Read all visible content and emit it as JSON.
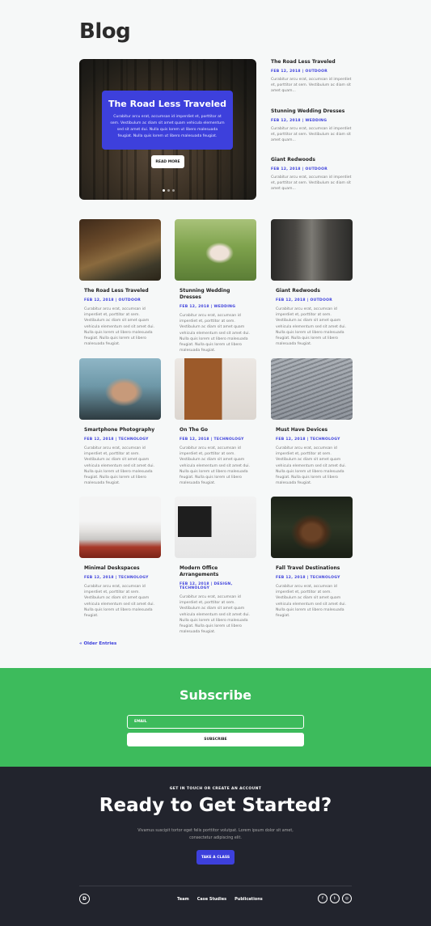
{
  "header": {
    "title": "Blog"
  },
  "slider": {
    "title": "The Road Less Traveled",
    "text": "Curabitur arcu erat, accumsan id imperdiet et, porttitor at sem. Vestibulum ac diam sit amet quam vehicula elementum sed sit amet dui. Nulla quis lorem ut libero malesuada feugiat. Nulla quis lorem ut libero malesuada feugiat.",
    "button": "READ MORE"
  },
  "side_posts": [
    {
      "title": "The Road Less Traveled",
      "meta": "FEB 12, 2018 | OUTDOOR",
      "excerpt": "Curabitur arcu erat, accumsan id imperdiet et, porttitor at sem. Vestibulum ac diam sit amet quam..."
    },
    {
      "title": "Stunning Wedding Dresses",
      "meta": "FEB 12, 2018 | WEDDING",
      "excerpt": "Curabitur arcu erat, accumsan id imperdiet et, porttitor at sem. Vestibulum ac diam sit amet quam..."
    },
    {
      "title": "Giant Redwoods",
      "meta": "FEB 12, 2018 | OUTDOOR",
      "excerpt": "Curabitur arcu erat, accumsan id imperdiet et, porttitor at sem. Vestibulum ac diam sit amet quam..."
    }
  ],
  "posts": [
    {
      "title": "The Road Less Traveled",
      "meta": "FEB 12, 2018 | OUTDOOR",
      "excerpt": "Curabitur arcu erat, accumsan id imperdiet et, porttitor at sem. Vestibulum ac diam sit amet quam vehicula elementum sed sit amet dui. Nulla quis lorem ut libero malesuada feugiat. Nulla quis lorem ut libero malesuada feugiat."
    },
    {
      "title": "Stunning Wedding Dresses",
      "meta": "FEB 12, 2018 | WEDDING",
      "excerpt": "Curabitur arcu erat, accumsan id imperdiet et, porttitor at sem. Vestibulum ac diam sit amet quam vehicula elementum sed sit amet dui. Nulla quis lorem ut libero malesuada feugiat. Nulla quis lorem ut libero malesuada feugiat."
    },
    {
      "title": "Giant Redwoods",
      "meta": "FEB 12, 2018 | OUTDOOR",
      "excerpt": "Curabitur arcu erat, accumsan id imperdiet et, porttitor at sem. Vestibulum ac diam sit amet quam vehicula elementum sed sit amet dui. Nulla quis lorem ut libero malesuada feugiat. Nulla quis lorem ut libero malesuada feugiat."
    },
    {
      "title": "Smartphone Photography",
      "meta": "FEB 12, 2018 | TECHNOLOGY",
      "excerpt": "Curabitur arcu erat, accumsan id imperdiet et, porttitor at sem. Vestibulum ac diam sit amet quam vehicula elementum sed sit amet dui. Nulla quis lorem ut libero malesuada feugiat. Nulla quis lorem ut libero malesuada feugiat."
    },
    {
      "title": "On The Go",
      "meta": "FEB 12, 2018 | TECHNOLOGY",
      "excerpt": "Curabitur arcu erat, accumsan id imperdiet et, porttitor at sem. Vestibulum ac diam sit amet quam vehicula elementum sed sit amet dui. Nulla quis lorem ut libero malesuada feugiat. Nulla quis lorem ut libero malesuada feugiat."
    },
    {
      "title": "Must Have Devices",
      "meta": "FEB 12, 2018 | TECHNOLOGY",
      "excerpt": "Curabitur arcu erat, accumsan id imperdiet et, porttitor at sem. Vestibulum ac diam sit amet quam vehicula elementum sed sit amet dui. Nulla quis lorem ut libero malesuada feugiat. Nulla quis lorem ut libero malesuada feugiat."
    },
    {
      "title": "Minimal Deskspaces",
      "meta": "FEB 12, 2018 | TECHNOLOGY",
      "excerpt": "Curabitur arcu erat, accumsan id imperdiet et, porttitor at sem. Vestibulum ac diam sit amet quam vehicula elementum sed sit amet dui. Nulla quis lorem ut libero malesuada feugiat."
    },
    {
      "title": "Modern Office Arrangements",
      "meta": "FEB 12, 2018 | DESIGN, TECHNOLOGY",
      "excerpt": "Curabitur arcu erat, accumsan id imperdiet et, porttitor at sem. Vestibulum ac diam sit amet quam vehicula elementum sed sit amet dui. Nulla quis lorem ut libero malesuada feugiat. Nulla quis lorem ut libero malesuada feugiat."
    },
    {
      "title": "Fall Travel Destinations",
      "meta": "FEB 12, 2018 | TECHNOLOGY",
      "excerpt": "Curabitur arcu erat, accumsan id imperdiet et, porttitor at sem. Vestibulum ac diam sit amet quam vehicula elementum sed sit amet dui. Nulla quis lorem ut libero malesuada feugiat."
    }
  ],
  "pagination": {
    "older": "« Older Entries"
  },
  "subscribe": {
    "title": "Subscribe",
    "email_placeholder": "EMAIL",
    "button": "SUBSCRIBE"
  },
  "footer": {
    "eyebrow": "GET IN TOUCH OR CREATE AN ACCOUNT",
    "title": "Ready to Get Started?",
    "text": "Vivamus suscipit tortor eget felis porttitor volutpat. Lorem ipsum dolor sit amet, consectetur adipiscing elit.",
    "button": "TAKE A CLASS",
    "logo": "D",
    "links": [
      "Team",
      "Case Studies",
      "Publications"
    ],
    "socials": [
      "f",
      "t",
      "◎"
    ]
  },
  "colors": {
    "accent": "#3d40dc",
    "subscribe_bg": "#3dbb5c",
    "footer_bg": "#22242d"
  }
}
